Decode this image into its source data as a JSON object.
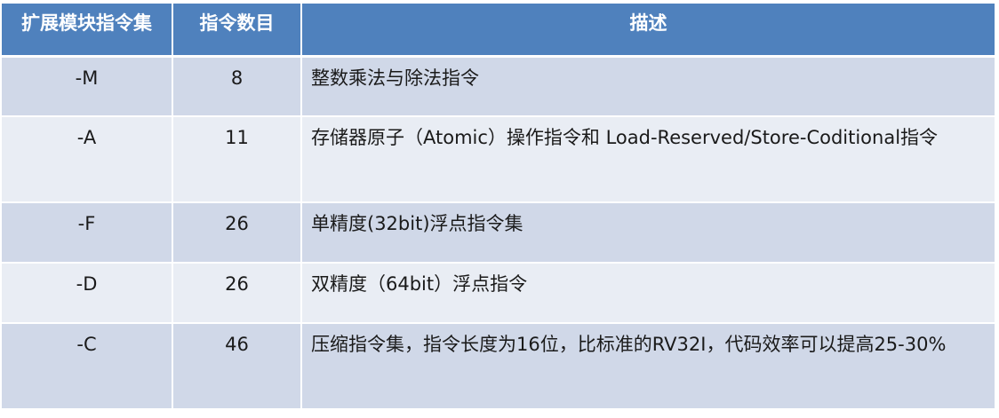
{
  "headers": [
    "扩展模块指令集",
    "指令数目",
    "描述"
  ],
  "rows": [
    {
      "module": "-M",
      "count": "8",
      "desc": "整数乘法与除法指令"
    },
    {
      "module": "-A",
      "count": "11",
      "desc": "存储器原子（Atomic）操作指令和 Load-Reserved/Store-Coditional指令"
    },
    {
      "module": "-F",
      "count": "26",
      "desc": "单精度(32bit)浮点指令集"
    },
    {
      "module": "-D",
      "count": "26",
      "desc": "双精度（64bit）浮点指令"
    },
    {
      "module": "-C",
      "count": "46",
      "desc": "压缩指令集，指令长度为16位，比标准的RV32I，代码效率可以提高25-30%"
    }
  ],
  "colors": {
    "header_bg": "#4f81bd",
    "row_bg": "#d0d8e8",
    "row_alt_bg": "#e9edf4",
    "header_text": "#ffffff"
  }
}
